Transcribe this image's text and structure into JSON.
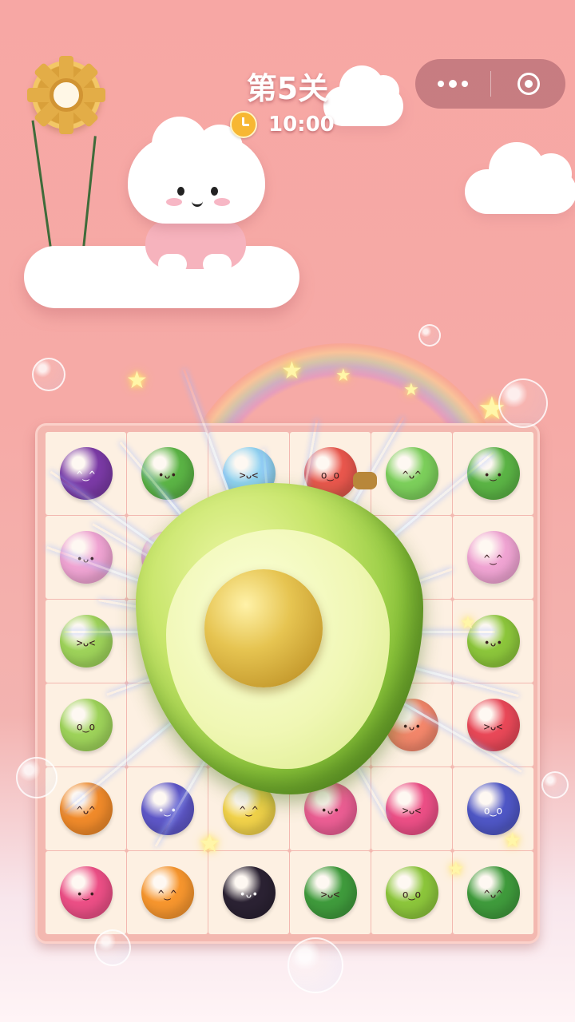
{
  "header": {
    "level_title": "第5关",
    "timer": "10:00"
  },
  "capsule": {
    "more_icon": "more-dots-icon",
    "close_icon": "target-close-icon"
  },
  "settings": {
    "icon": "gear-icon"
  },
  "board": {
    "rows": 6,
    "cols": 6,
    "tiles": [
      [
        "eggplant",
        "broccoli",
        "water-drop",
        "tomato",
        "melon",
        "broccoli"
      ],
      [
        "grapes",
        "grapes",
        "",
        "",
        "",
        "grapes"
      ],
      [
        "apple",
        "",
        "",
        "",
        "",
        "avocado"
      ],
      [
        "apple",
        "",
        "",
        "",
        "grapefruit",
        "strawberry"
      ],
      [
        "orange-pumpkin",
        "blueberries",
        "corn",
        "raspberry",
        "dragonfruit",
        "blueberry"
      ],
      [
        "dragonfruit",
        "orange",
        "blackberry",
        "watermelon",
        "avocado",
        "watermelon"
      ]
    ]
  },
  "highlight": {
    "item": "avocado"
  },
  "colors": {
    "eggplant": "#7b3aa6",
    "broccoli": "#5bb445",
    "water-drop": "#8fd3f2",
    "tomato": "#e9574d",
    "melon": "#7ccf5b",
    "grapes": "#f0a4d3",
    "apple": "#9ed35a",
    "avocado": "#8cc63b",
    "grapefruit": "#f4876b",
    "strawberry": "#e94858",
    "orange-pumpkin": "#f08a2a",
    "blueberries": "#5e57c8",
    "corn": "#f1d24a",
    "raspberry": "#ec5e94",
    "dragonfruit": "#ec4f86",
    "blueberry": "#4f57c6",
    "orange": "#f7962e",
    "blackberry": "#2b2233",
    "watermelon": "#3f9b3c"
  }
}
